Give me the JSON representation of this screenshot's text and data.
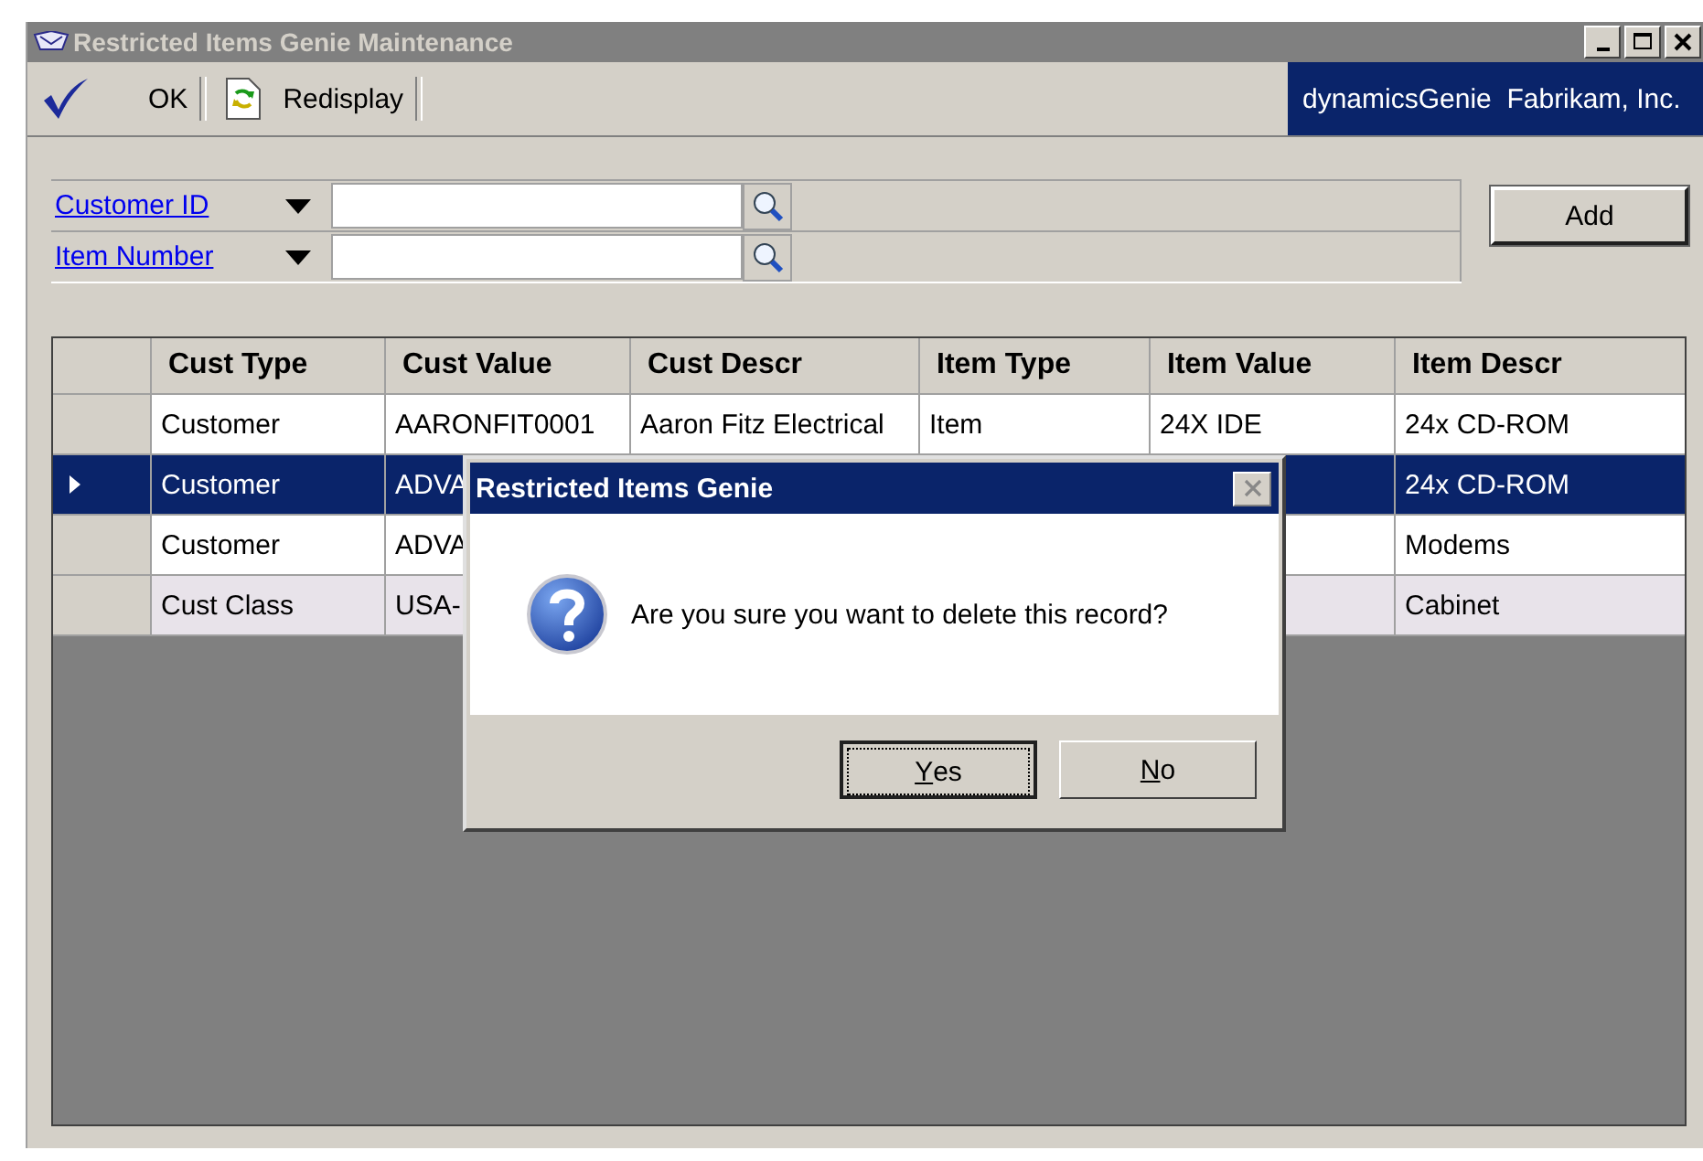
{
  "window": {
    "title": "Restricted Items Genie Maintenance",
    "active": false
  },
  "toolbar": {
    "buttons": [
      {
        "kind": "check",
        "label": "OK"
      },
      {
        "kind": "refresh",
        "label": "Redisplay"
      }
    ],
    "company": "dynamicsGenie  Fabrikam, Inc."
  },
  "filters": [
    {
      "label": "Customer ID"
    },
    {
      "label": "Item Number"
    }
  ],
  "add_button": "Add",
  "table": {
    "columns": [
      "Cust Type",
      "Cust Value",
      "Cust Descr",
      "Item Type",
      "Item Value",
      "Item Descr"
    ],
    "rows": [
      {
        "selected": false,
        "shaded": false,
        "cells": [
          "Customer",
          "AARONFIT0001",
          "Aaron Fitz Electrical",
          "Item",
          "24X IDE",
          "24x CD-ROM"
        ]
      },
      {
        "selected": true,
        "shaded": false,
        "cells": [
          "Customer",
          "ADVA",
          null,
          null,
          null,
          "24x CD-ROM"
        ]
      },
      {
        "selected": false,
        "shaded": false,
        "cells": [
          "Customer",
          "ADVA",
          null,
          null,
          null,
          "Modems"
        ]
      },
      {
        "selected": false,
        "shaded": true,
        "cells": [
          "Cust Class",
          "USA-",
          null,
          null,
          null,
          "Cabinet"
        ]
      }
    ]
  },
  "dialog": {
    "title": "Restricted Items Genie",
    "message": "Are you sure you want to delete this record?",
    "buttons": [
      {
        "label": "Yes",
        "default": true,
        "underline_first": true
      },
      {
        "label": "No",
        "default": false,
        "underline_first": true
      }
    ]
  }
}
